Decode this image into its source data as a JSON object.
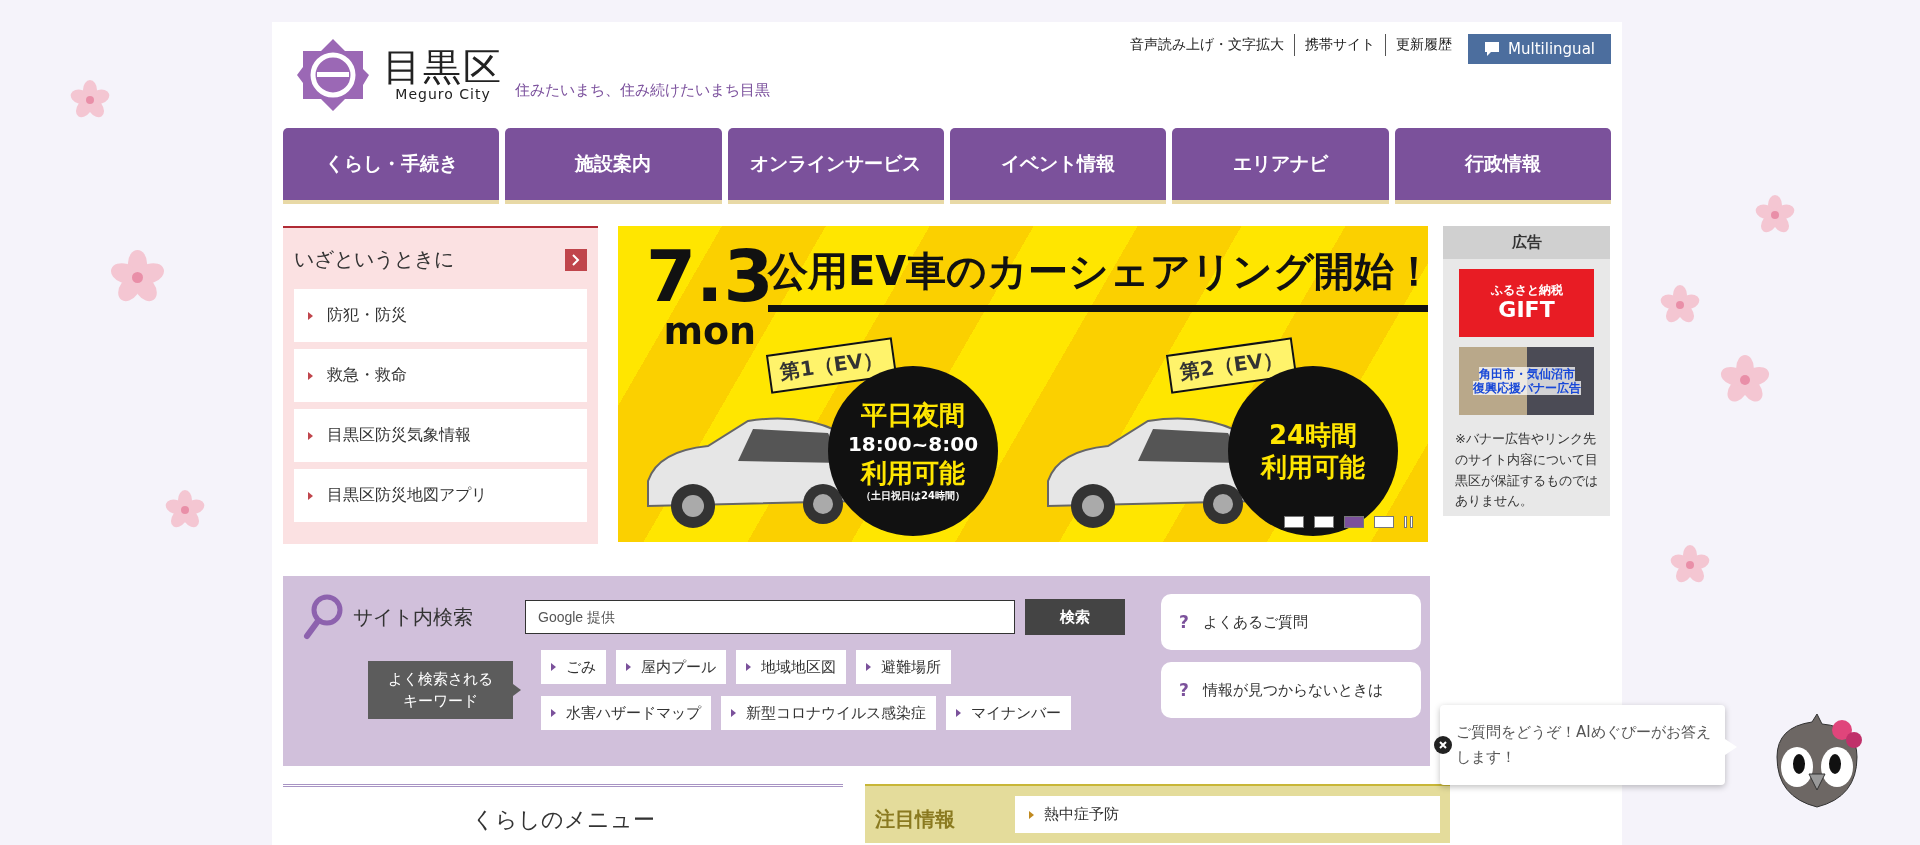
{
  "header": {
    "logo_name": "目黒区",
    "logo_sub": "Meguro City",
    "tagline": "住みたいまち、住み続けたいまち目黒",
    "utility_links": [
      "音声読み上げ・文字拡大",
      "携帯サイト",
      "更新履歴"
    ],
    "multilingual": "Multilingual"
  },
  "nav": [
    {
      "label": "くらし・手続き"
    },
    {
      "label": "施設案内"
    },
    {
      "label": "オンラインサービス"
    },
    {
      "label": "イベント情報"
    },
    {
      "label": "エリアナビ"
    },
    {
      "label": "行政情報"
    }
  ],
  "emergency": {
    "title": "いざというときに",
    "items": [
      "防犯・防災",
      "救急・救命",
      "目黒区防災気象情報",
      "目黒区防災地図アプリ"
    ]
  },
  "banner": {
    "date": "7.3",
    "day": "mon",
    "headline": "公用EV車のカーシェアリング開始！",
    "cars": [
      {
        "flag": "第1（EV）",
        "lines": [
          "平日夜間",
          "18:00~8:00",
          "利用可能"
        ],
        "note": "（土日祝日は24時間）"
      },
      {
        "flag": "第2（EV）",
        "lines": [
          "24時間",
          "利用可能"
        ]
      }
    ],
    "indicators": [
      {
        "selected": false
      },
      {
        "selected": false
      },
      {
        "selected": true
      },
      {
        "selected": false
      }
    ]
  },
  "ads": {
    "title": "広告",
    "banners": [
      {
        "kind": "red",
        "lines": [
          "ふるさと納税",
          "GIFT"
        ]
      },
      {
        "kind": "photo",
        "lines": [
          "角田市・気仙沼市",
          "復興応援バナー広告"
        ]
      }
    ],
    "note": "※バナー広告やリンク先のサイト内容について目黒区が保証するものではありません。"
  },
  "search": {
    "label": "サイト内検索",
    "placeholder": "Google 提供",
    "button": "検索",
    "keywords_label": "よく検索されるキーワード",
    "keywords": [
      "ごみ",
      "屋内プール",
      "地域地区図",
      "避難場所",
      "水害ハザードマップ",
      "新型コロナウイルス感染症",
      "マイナンバー"
    ],
    "help_links": [
      {
        "icon": "?",
        "label": "よくあるご質問"
      },
      {
        "icon": "?",
        "label": "情報が見つからないときは"
      }
    ]
  },
  "lower": {
    "menu_title": "くらしのメニュー",
    "featured_title": "注目情報",
    "featured_items": [
      "熱中症予防"
    ]
  },
  "chatbot": {
    "message": "ご質問をどうぞ！AIめぐぴーがお答えします！"
  }
}
